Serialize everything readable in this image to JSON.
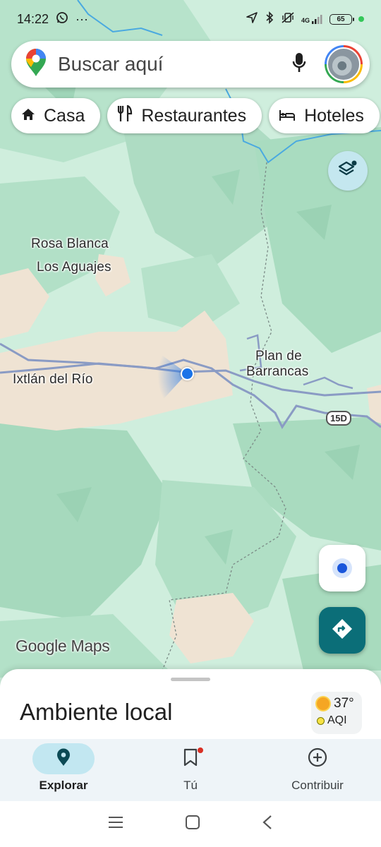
{
  "status_bar": {
    "time": "14:22",
    "more": "···",
    "network": "4G",
    "battery": "65"
  },
  "search": {
    "placeholder": "Buscar aquí"
  },
  "chips": [
    {
      "label": "Casa",
      "icon": "home-icon"
    },
    {
      "label": "Restaurantes",
      "icon": "restaurant-icon"
    },
    {
      "label": "Hoteles",
      "icon": "hotel-icon"
    }
  ],
  "map": {
    "labels": {
      "rosa_blanca": "Rosa Blanca",
      "los_aguajes": "Los Aguajes",
      "ixtlan": "Ixtlán del Río",
      "plan_line1": "Plan de",
      "plan_line2": "Barrancas"
    },
    "route_shield": "15D",
    "attribution": "Google Maps",
    "colors": {
      "land": "#cfeedd",
      "forest": "#a9dcc0",
      "urban": "#efe3d3",
      "road": "#8a9bc4",
      "river": "#4aa9e0",
      "location_dot": "#1a73e8"
    }
  },
  "bottom_sheet": {
    "title": "Ambiente local",
    "weather": {
      "temperature": "37°",
      "aqi_label": "AQI"
    }
  },
  "bottom_nav": [
    {
      "label": "Explorar",
      "icon": "location-pin-icon",
      "active": true
    },
    {
      "label": "Tú",
      "icon": "bookmark-icon",
      "active": false
    },
    {
      "label": "Contribuir",
      "icon": "add-circle-icon",
      "active": false
    }
  ]
}
